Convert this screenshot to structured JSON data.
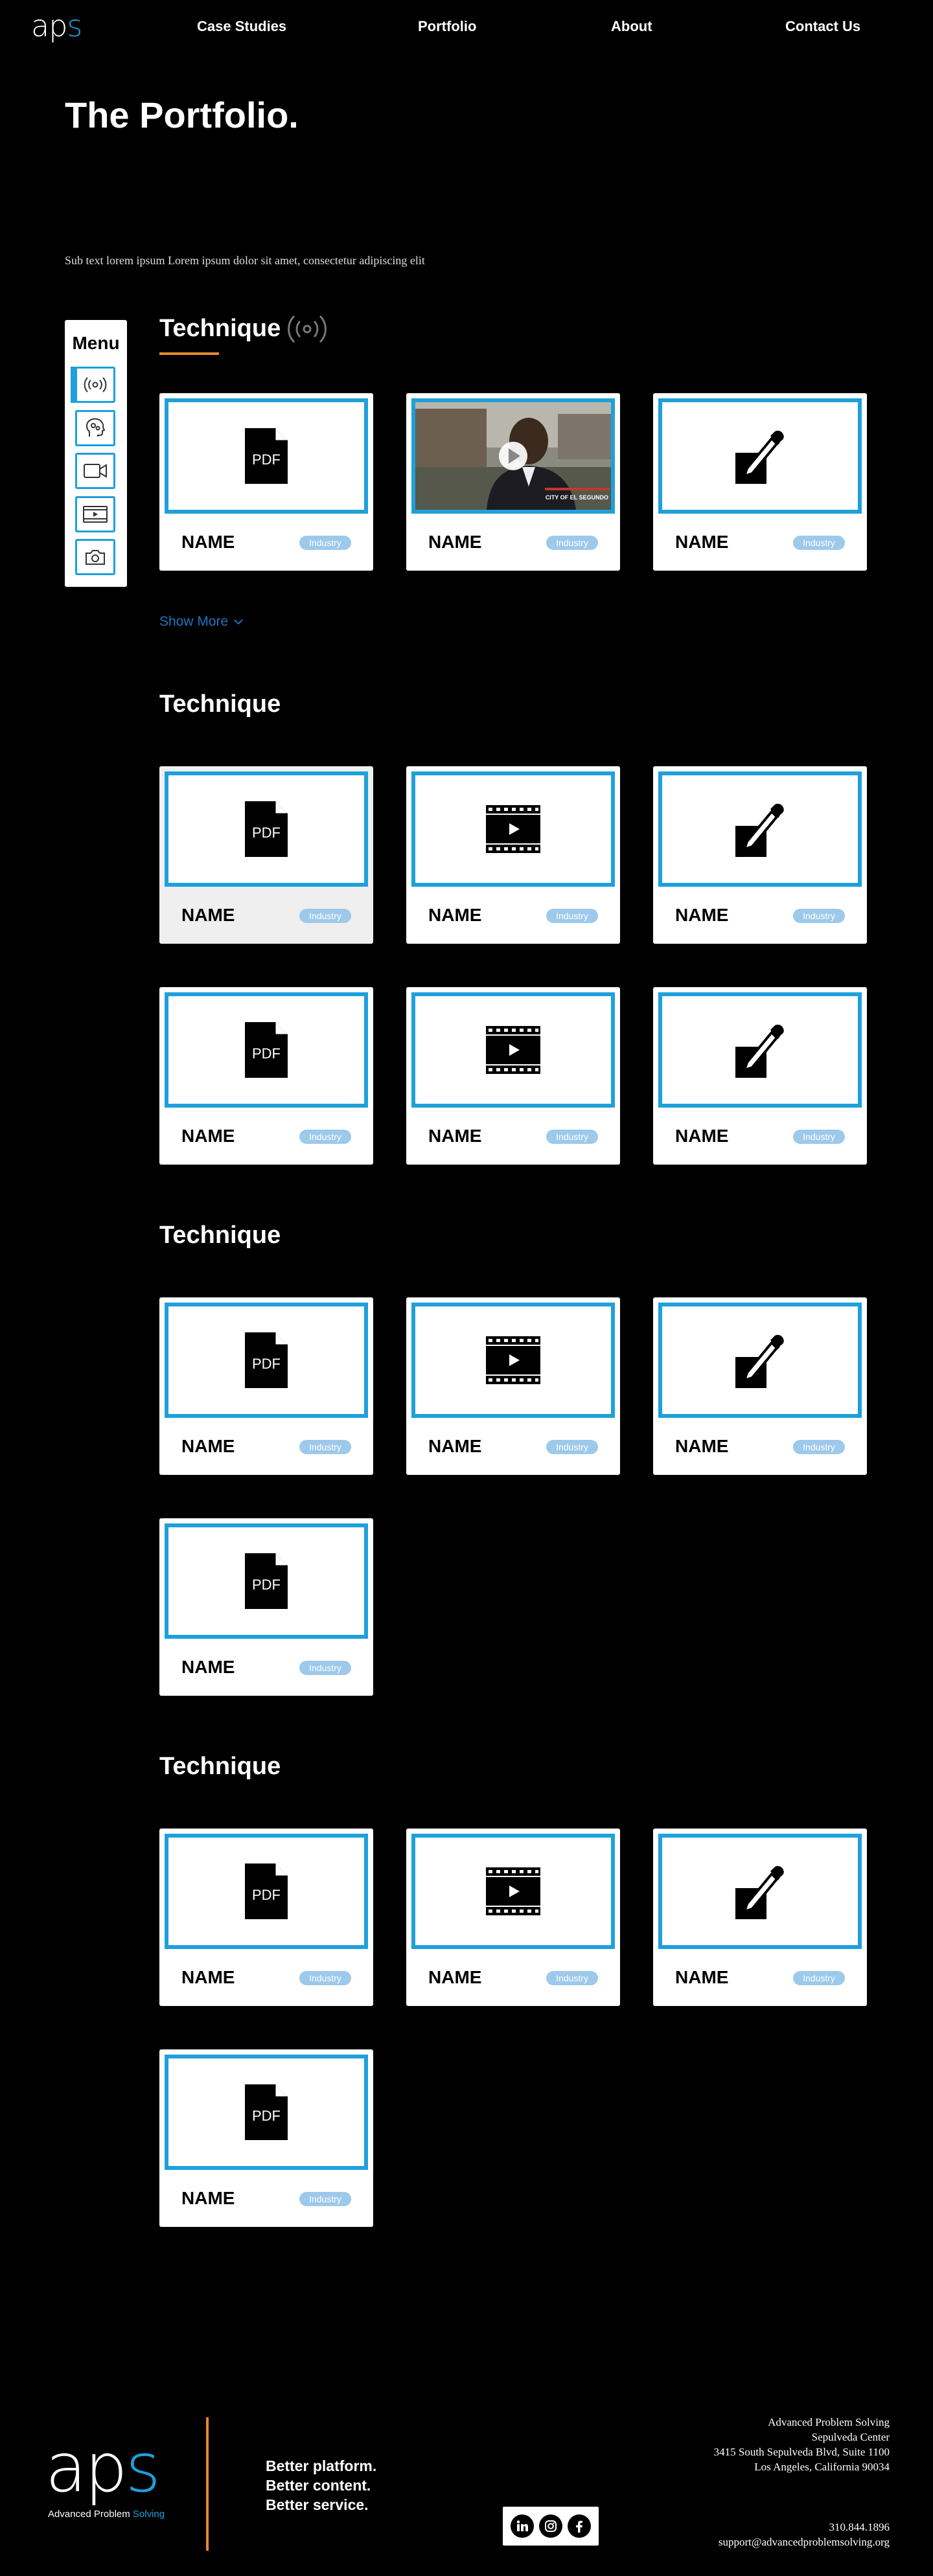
{
  "nav": {
    "logo_a": "a",
    "logo_p": "p",
    "logo_s": "s",
    "links": [
      "Case Studies",
      "Portfolio",
      "About",
      "Contact Us"
    ]
  },
  "hero": {
    "title": "The Portfolio.",
    "subtitle": "Sub text lorem ipsum Lorem ipsum dolor sit amet, consectetur adipiscing elit"
  },
  "menu": {
    "title": "Menu",
    "items": [
      "broadcast-icon",
      "head-gears-icon",
      "video-camera-icon",
      "video-player-icon",
      "camera-icon"
    ]
  },
  "sections": [
    {
      "title": "Technique",
      "icon": "broadcast-icon"
    },
    {
      "title": "Technique"
    },
    {
      "title": "Technique"
    },
    {
      "title": "Technique"
    }
  ],
  "show_more": "Show More",
  "card": {
    "name": "NAME",
    "tag": "Industry",
    "pdf_label": "PDF"
  },
  "video_thumb": {
    "line1": "CITY OF EL SEGUNDO"
  },
  "footer": {
    "logo_a": "a",
    "logo_p": "p",
    "logo_s": "s",
    "tagline_a": "Advanced Problem ",
    "tagline_b": "Solving",
    "slogan": [
      "Better platform.",
      "Better content.",
      "Better service."
    ],
    "address": [
      "Advanced Problem Solving",
      "Sepulveda Center",
      "3415 South Sepulveda Blvd, Suite 1100",
      "Los Angeles, California 90034"
    ],
    "phone": "310.844.1896",
    "email": "support@advancedproblemsolving.org",
    "social": [
      "linkedin-icon",
      "instagram-icon",
      "facebook-icon"
    ]
  },
  "colors": {
    "accent_blue": "#1ea0dc",
    "accent_orange": "#e8892f",
    "tag_blue": "#9dc9eb",
    "link_blue": "#1e73be"
  }
}
